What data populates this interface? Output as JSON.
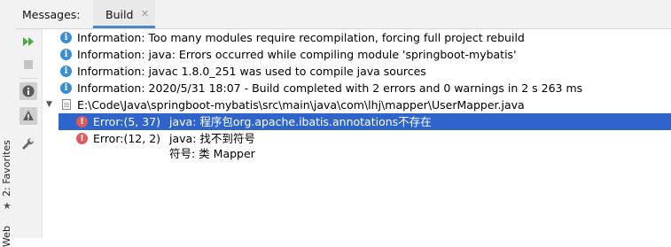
{
  "side_strip": {
    "favorites_label": "2: Favorites",
    "web_label": "Web"
  },
  "header": {
    "title": "Messages:",
    "tab_label": "Build",
    "tab_close": "✕"
  },
  "toolbar": {
    "icons": [
      "rerun-icon",
      "stop-icon",
      "info-filter-icon",
      "warning-filter-icon",
      "settings-wrench-icon"
    ]
  },
  "messages": {
    "info": [
      "Information: Too many modules require recompilation, forcing full project rebuild",
      "Information: java: Errors occurred while compiling module 'springboot-mybatis'",
      "Information: javac 1.8.0_251 was used to compile java sources",
      "Information: 2020/5/31 18:07 - Build completed with 2 errors and 0 warnings in 2 s 263 ms"
    ],
    "file_path": "E:\\Code\\Java\\springboot-mybatis\\src\\main\\java\\com\\lhj\\mapper\\UserMapper.java",
    "errors": [
      {
        "location": "Error:(5, 37)",
        "text": "java: 程序包org.apache.ibatis.annotations不存在",
        "selected": true
      },
      {
        "location": "Error:(12, 2)",
        "text": "java: 找不到符号",
        "detail": "符号: 类 Mapper",
        "selected": false
      }
    ]
  },
  "colors": {
    "selection": "#2f65ca",
    "info_icon": "#3a8fd4",
    "error_icon": "#dc5c5c",
    "run_icon": "#4aa845",
    "tab_underline": "#4a88c7"
  }
}
